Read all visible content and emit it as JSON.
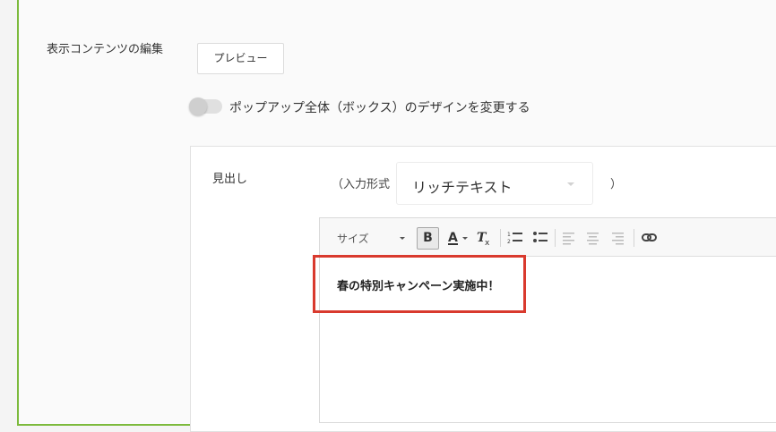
{
  "section": {
    "label": "表示コンテンツの編集",
    "preview_button": "プレビュー",
    "toggle_label": "ポップアップ全体（ボックス）のデザインを変更する",
    "toggle_on": false
  },
  "heading_field": {
    "label": "見出し",
    "input_format_open": "（入力形式",
    "input_format_close": "）",
    "format_select": {
      "value": "リッチテキスト"
    }
  },
  "editor": {
    "toolbar": {
      "size_label": "サイズ",
      "bold_label": "B",
      "text_color_label": "A",
      "remove_format_label": "Tx",
      "bold_active": true
    },
    "content": "春の特別キャンペーン実施中！"
  },
  "colors": {
    "frame_border": "#7cba3c",
    "highlight": "#d93a2e"
  }
}
